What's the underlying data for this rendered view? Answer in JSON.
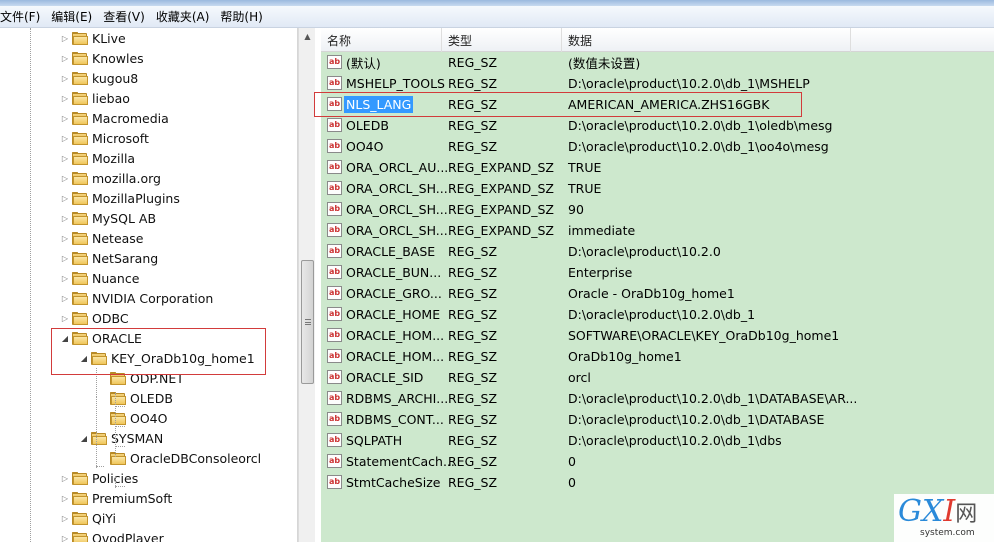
{
  "menu": [
    "文件(F)",
    "编辑(E)",
    "查看(V)",
    "收藏夹(A)",
    "帮助(H)"
  ],
  "tree": {
    "items": [
      {
        "label": "KLive",
        "expanded": false
      },
      {
        "label": "Knowles",
        "expanded": false
      },
      {
        "label": "kugou8",
        "expanded": false
      },
      {
        "label": "liebao",
        "expanded": false
      },
      {
        "label": "Macromedia",
        "expanded": false
      },
      {
        "label": "Microsoft",
        "expanded": false
      },
      {
        "label": "Mozilla",
        "expanded": false
      },
      {
        "label": "mozilla.org",
        "expanded": false
      },
      {
        "label": "MozillaPlugins",
        "expanded": false
      },
      {
        "label": "MySQL AB",
        "expanded": false
      },
      {
        "label": "Netease",
        "expanded": false
      },
      {
        "label": "NetSarang",
        "expanded": false
      },
      {
        "label": "Nuance",
        "expanded": false
      },
      {
        "label": "NVIDIA Corporation",
        "expanded": false
      },
      {
        "label": "ODBC",
        "expanded": false
      },
      {
        "label": "ORACLE",
        "expanded": true
      },
      {
        "label": "KEY_OraDb10g_home1",
        "expanded": true
      },
      {
        "label": "ODP.NET",
        "expanded": false
      },
      {
        "label": "OLEDB",
        "expanded": false
      },
      {
        "label": "OO4O",
        "expanded": false
      },
      {
        "label": "SYSMAN",
        "expanded": true
      },
      {
        "label": "OracleDBConsoleorcl",
        "expanded": false
      },
      {
        "label": "Policies",
        "expanded": false
      },
      {
        "label": "PremiumSoft",
        "expanded": false
      },
      {
        "label": "QiYi",
        "expanded": false
      },
      {
        "label": "QvodPlayer",
        "expanded": false
      }
    ]
  },
  "values": {
    "columns": [
      "名称",
      "类型",
      "数据"
    ],
    "rows": [
      {
        "name": "(默认)",
        "type": "REG_SZ",
        "data": "(数值未设置)"
      },
      {
        "name": "MSHELP_TOOLS",
        "type": "REG_SZ",
        "data": "D:\\oracle\\product\\10.2.0\\db_1\\MSHELP"
      },
      {
        "name": "NLS_LANG",
        "type": "REG_SZ",
        "data": "AMERICAN_AMERICA.ZHS16GBK",
        "selected": true
      },
      {
        "name": "OLEDB",
        "type": "REG_SZ",
        "data": "D:\\oracle\\product\\10.2.0\\db_1\\oledb\\mesg"
      },
      {
        "name": "OO4O",
        "type": "REG_SZ",
        "data": "D:\\oracle\\product\\10.2.0\\db_1\\oo4o\\mesg"
      },
      {
        "name": "ORA_ORCL_AU...",
        "type": "REG_EXPAND_SZ",
        "data": "TRUE"
      },
      {
        "name": "ORA_ORCL_SH...",
        "type": "REG_EXPAND_SZ",
        "data": "TRUE"
      },
      {
        "name": "ORA_ORCL_SH...",
        "type": "REG_EXPAND_SZ",
        "data": "90"
      },
      {
        "name": "ORA_ORCL_SH...",
        "type": "REG_EXPAND_SZ",
        "data": "immediate"
      },
      {
        "name": "ORACLE_BASE",
        "type": "REG_SZ",
        "data": "D:\\oracle\\product\\10.2.0"
      },
      {
        "name": "ORACLE_BUN...",
        "type": "REG_SZ",
        "data": "Enterprise"
      },
      {
        "name": "ORACLE_GRO...",
        "type": "REG_SZ",
        "data": "Oracle - OraDb10g_home1"
      },
      {
        "name": "ORACLE_HOME",
        "type": "REG_SZ",
        "data": "D:\\oracle\\product\\10.2.0\\db_1"
      },
      {
        "name": "ORACLE_HOM...",
        "type": "REG_SZ",
        "data": "SOFTWARE\\ORACLE\\KEY_OraDb10g_home1"
      },
      {
        "name": "ORACLE_HOM...",
        "type": "REG_SZ",
        "data": "OraDb10g_home1"
      },
      {
        "name": "ORACLE_SID",
        "type": "REG_SZ",
        "data": "orcl"
      },
      {
        "name": "RDBMS_ARCHI...",
        "type": "REG_SZ",
        "data": "D:\\oracle\\product\\10.2.0\\db_1\\DATABASE\\AR..."
      },
      {
        "name": "RDBMS_CONT...",
        "type": "REG_SZ",
        "data": "D:\\oracle\\product\\10.2.0\\db_1\\DATABASE"
      },
      {
        "name": "SQLPATH",
        "type": "REG_SZ",
        "data": "D:\\oracle\\product\\10.2.0\\db_1\\dbs"
      },
      {
        "name": "StatementCach...",
        "type": "REG_SZ",
        "data": "0"
      },
      {
        "name": "StmtCacheSize",
        "type": "REG_SZ",
        "data": "0"
      }
    ]
  },
  "watermark": {
    "logo_g": "G",
    "logo_x": "X",
    "logo_i": "I",
    "logo_net": "网",
    "site": "system.com"
  }
}
